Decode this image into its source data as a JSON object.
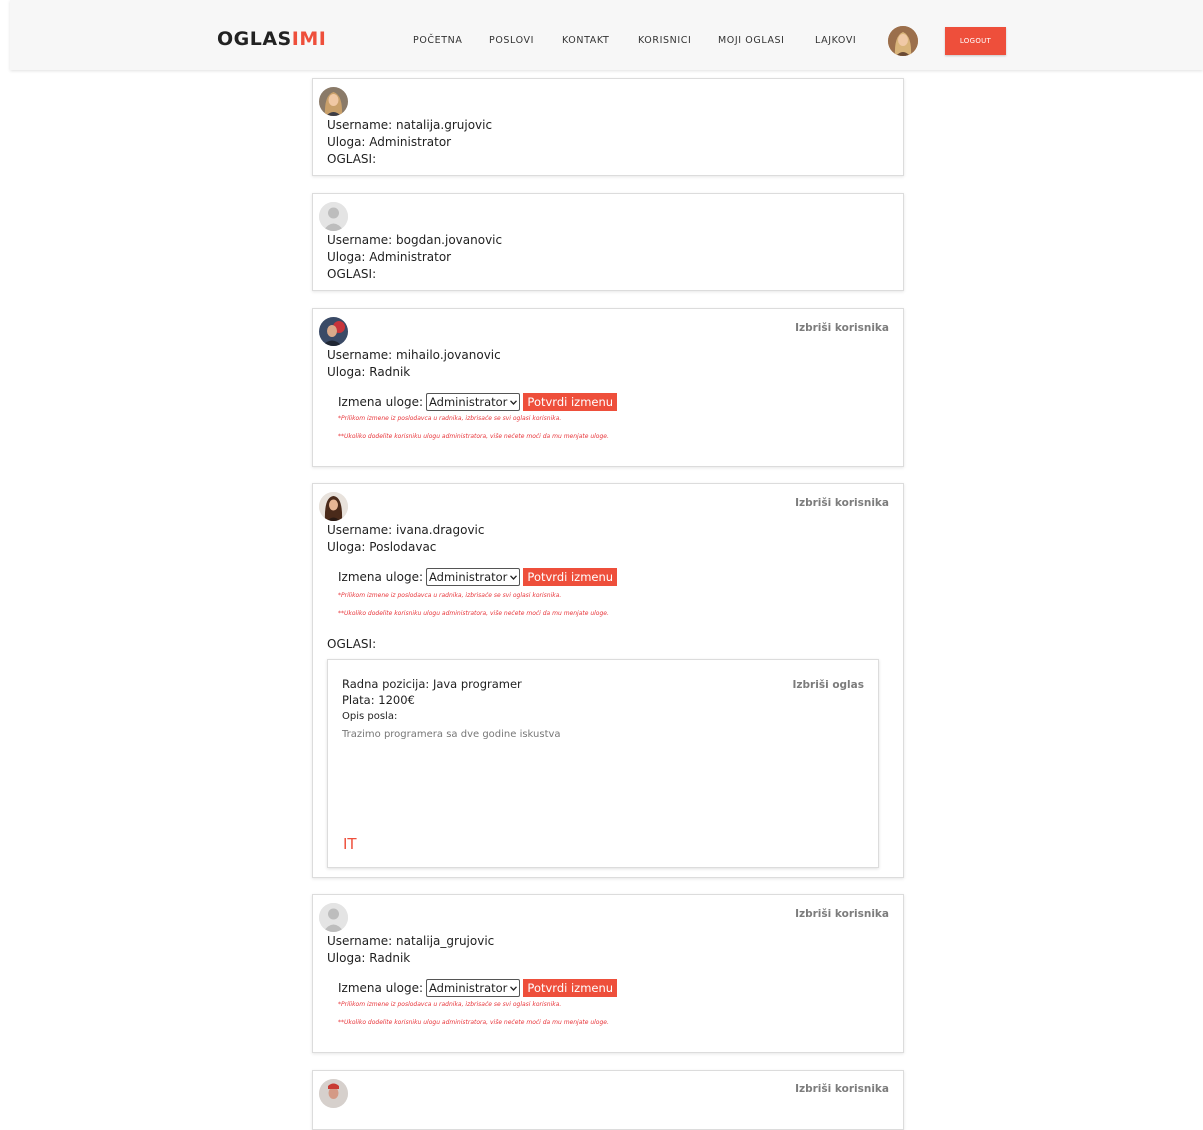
{
  "navbar": {
    "logo_main": "OGLAS",
    "logo_accent": "IMI",
    "links": [
      "POČETNA",
      "POSLOVI",
      "KONTAKT",
      "KORISNICI",
      "MOJI OGLASI",
      "LAJKOVI"
    ],
    "logout_label": "LOGOUT"
  },
  "labels": {
    "username_prefix": "Username: ",
    "role_prefix": "Uloga: ",
    "ads_heading": "OGLASI:",
    "delete_user": "Izbriši korisnika",
    "change_role": "Izmena uloge:",
    "confirm_change": "Potvrdi izmenu",
    "warning_1": "*Prilikom izmene iz poslodavca u radnika, izbrisaće se svi oglasi korisnika.",
    "warning_2": "**Ukoliko dodelite korisniku ulogu administratora, više nećete moći da mu menjate uloge.",
    "delete_ad": "Izbriši oglas",
    "position_prefix": "Radna pozicija: ",
    "salary_prefix": "Plata: ",
    "description_label": "Opis posla:"
  },
  "colors": {
    "accent": "#ee4f3b",
    "warning": "#e8363b"
  },
  "role_select": {
    "selected": "Administrator"
  },
  "users": [
    {
      "username": "natalija.grujovic",
      "role": "Administrator",
      "avatar": "photo-woman-blonde"
    },
    {
      "username": "bogdan.jovanovic",
      "role": "Administrator",
      "avatar": "default-user-icon"
    },
    {
      "username": "mihailo.jovanovic",
      "role": "Radnik",
      "avatar": "photo-man"
    },
    {
      "username": "ivana.dragovic",
      "role": "Poslodavac",
      "avatar": "photo-woman-brunette",
      "ads": [
        {
          "position": "Java programer",
          "salary": "1200€",
          "description": "Trazimo programera sa dve godine iskustva",
          "category": "IT"
        }
      ]
    },
    {
      "username": "natalija_grujovic",
      "role": "Radnik",
      "avatar": "default-user-icon"
    }
  ]
}
